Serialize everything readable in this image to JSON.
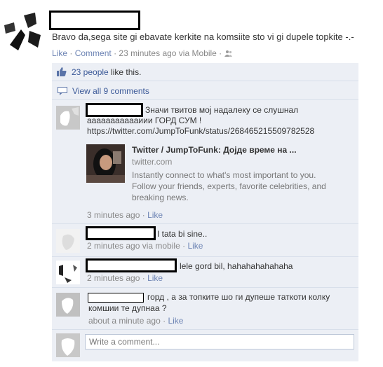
{
  "post": {
    "text": "Bravo da,sega site gi ebavate kerkite na komsiite sto vi gi dupele topkite -.-",
    "actions": {
      "like": "Like",
      "sep1": "·",
      "comment": "Comment",
      "sep2": "·",
      "time": "23 minutes ago via Mobile",
      "sep3": "·"
    }
  },
  "likes": {
    "count": "23 people",
    "suffix": "like this."
  },
  "view_comments": "View all 9 comments",
  "comments": [
    {
      "text_line1": "Значи твитов мој надалеку се слушнал",
      "text_line2": "аааааааааааиии ГОРД СУМ !",
      "link": "https://twitter.com/JumpToFunk/status/268465215509782528",
      "share": {
        "title": "Twitter / JumpToFunk: Дојде време на ...",
        "domain": "twitter.com",
        "desc_line1": "Instantly connect to what's most important to you.",
        "desc_line2": "Follow your friends, experts, favorite celebrities, and",
        "desc_line3": "breaking news."
      },
      "time": "3 minutes ago",
      "sep": "·",
      "like": "Like"
    },
    {
      "text": "I tata bi sine..",
      "time": "2 minutes ago via mobile",
      "sep": "·",
      "like": "Like"
    },
    {
      "text": "lele gord bil, hahahahahahaha",
      "time": "2 minutes ago",
      "sep": "·",
      "like": "Like"
    },
    {
      "text_line1": "горд , а за топките шо ги дупеше таткоти колку",
      "text_line2": "комшии те дупнаа ?",
      "time": "about a minute ago",
      "sep": "·",
      "like": "Like"
    }
  ],
  "comment_input": {
    "placeholder": "Write a comment..."
  },
  "colors": {
    "link": "#3b5998",
    "ufi_bg": "#eceff5",
    "border": "#d8dfea",
    "meta": "#888888"
  },
  "icons": [
    "thumbs-up-icon",
    "comment-bubble-icon",
    "friends-icon"
  ]
}
